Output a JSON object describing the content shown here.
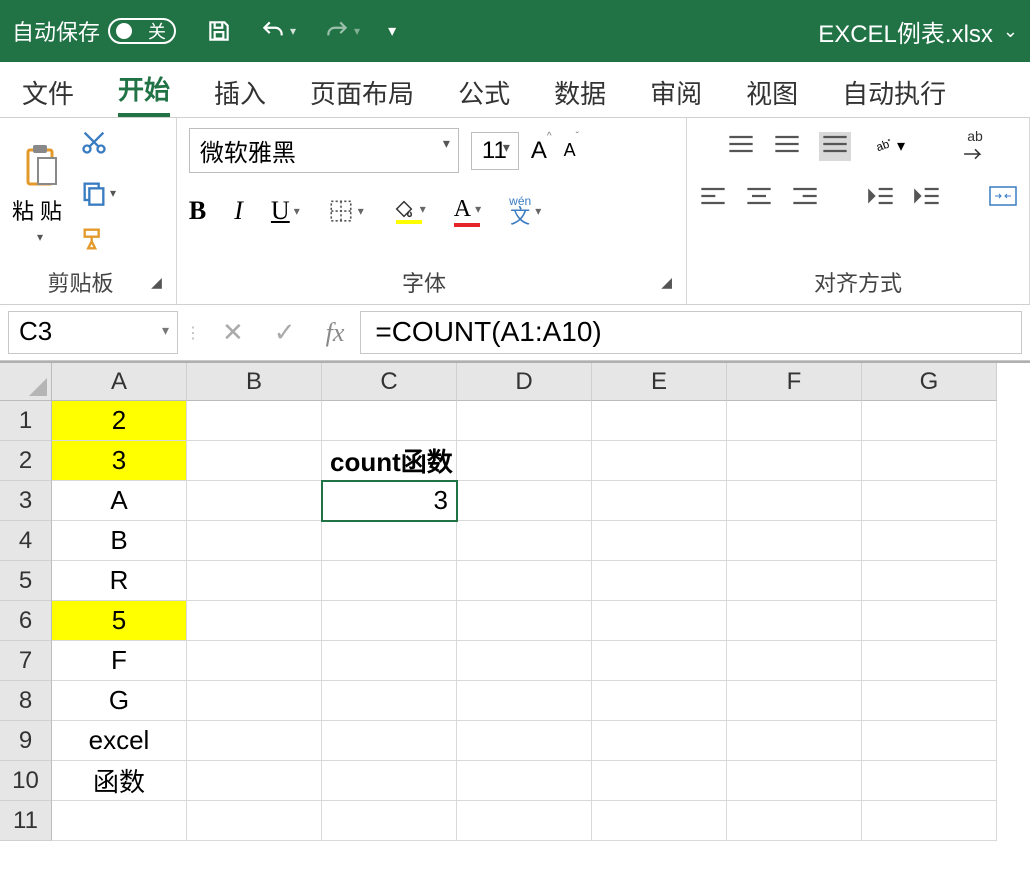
{
  "titlebar": {
    "autosave_label": "自动保存",
    "autosave_state": "关",
    "filename": "EXCEL例表.xlsx"
  },
  "tabs": [
    "文件",
    "开始",
    "插入",
    "页面布局",
    "公式",
    "数据",
    "审阅",
    "视图",
    "自动执行"
  ],
  "active_tab": "开始",
  "ribbon": {
    "clipboard": {
      "label": "剪贴板",
      "paste_label": "粘贴"
    },
    "font": {
      "label": "字体",
      "font_name": "微软雅黑",
      "font_size": "11",
      "wen": "wén",
      "wenchar": "文"
    },
    "align": {
      "label": "对齐方式"
    },
    "ab_label": "ab"
  },
  "formula_bar": {
    "name_box": "C3",
    "fx": "fx",
    "formula": "=COUNT(A1:A10)"
  },
  "columns": [
    "A",
    "B",
    "C",
    "D",
    "E",
    "F",
    "G"
  ],
  "row_numbers": [
    "1",
    "2",
    "3",
    "4",
    "5",
    "6",
    "7",
    "8",
    "9",
    "10",
    "11"
  ],
  "sheet": {
    "A1": {
      "v": "2",
      "hl": true
    },
    "A2": {
      "v": "3",
      "hl": true
    },
    "A3": {
      "v": "A"
    },
    "A4": {
      "v": "B"
    },
    "A5": {
      "v": "R"
    },
    "A6": {
      "v": "5",
      "hl": true
    },
    "A7": {
      "v": "F"
    },
    "A8": {
      "v": "G"
    },
    "A9": {
      "v": "excel"
    },
    "A10": {
      "v": "函数"
    },
    "C2": {
      "v": "count函数",
      "bold": true,
      "align": "left"
    },
    "C3": {
      "v": "3",
      "align": "right",
      "selected": true
    }
  },
  "chart_data": {
    "type": "table",
    "note": "Excel worksheet showing COUNT function result",
    "formula": "=COUNT(A1:A10)",
    "result_cell": "C3",
    "result_value": 3,
    "data_range": "A1:A10",
    "data_values": [
      "2",
      "3",
      "A",
      "B",
      "R",
      "5",
      "F",
      "G",
      "excel",
      "函数"
    ],
    "numeric_values_highlighted": [
      2,
      3,
      5
    ]
  }
}
